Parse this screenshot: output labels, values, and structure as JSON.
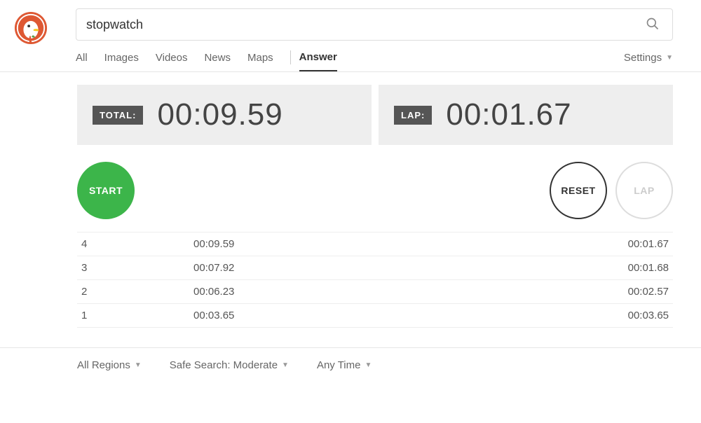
{
  "search": {
    "query": "stopwatch"
  },
  "tabs": {
    "all": "All",
    "images": "Images",
    "videos": "Videos",
    "news": "News",
    "maps": "Maps",
    "answer": "Answer"
  },
  "settings_label": "Settings",
  "timer": {
    "total_label": "TOTAL:",
    "total_value": "00:09.59",
    "lap_label": "LAP:",
    "lap_value": "00:01.67"
  },
  "buttons": {
    "start": "START",
    "reset": "RESET",
    "lap": "LAP"
  },
  "laps": [
    {
      "num": "4",
      "total": "00:09.59",
      "split": "00:01.67"
    },
    {
      "num": "3",
      "total": "00:07.92",
      "split": "00:01.68"
    },
    {
      "num": "2",
      "total": "00:06.23",
      "split": "00:02.57"
    },
    {
      "num": "1",
      "total": "00:03.65",
      "split": "00:03.65"
    }
  ],
  "footer": {
    "regions": "All Regions",
    "safesearch": "Safe Search: Moderate",
    "anytime": "Any Time"
  }
}
